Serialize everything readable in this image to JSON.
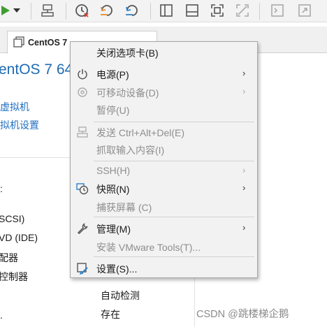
{
  "toolbar": {
    "icons": [
      "power-on-icon",
      "dropdown-arrow-icon",
      "send-ctrl-alt-del-icon",
      "snapshot-icon",
      "revert-snapshot-icon",
      "snapshot-manager-icon",
      "library-icon",
      "thumbnail-icon",
      "full-screen-icon",
      "unity-icon",
      "console-view-icon",
      "stretch-icon"
    ]
  },
  "tab": {
    "title": "CentOS 7"
  },
  "main": {
    "vm_title": "entOS 7 64",
    "links": [
      "虚拟机",
      "拟机设置"
    ],
    "devices": [
      "SCSI)",
      "VD (IDE)",
      "配器",
      "控制器"
    ],
    "right_values": [
      "自动检测",
      "存在"
    ]
  },
  "menu": {
    "items": [
      {
        "label": "关闭选项卡(B)",
        "enabled": true,
        "icon": "",
        "submenu": false
      },
      {
        "label": "电源(P)",
        "enabled": true,
        "icon": "power-icon",
        "submenu": true
      },
      {
        "label": "可移动设备(D)",
        "enabled": false,
        "icon": "removable-device-icon",
        "submenu": true
      },
      {
        "label": "暂停(U)",
        "enabled": false,
        "icon": "",
        "submenu": false
      },
      {
        "label": "发送 Ctrl+Alt+Del(E)",
        "enabled": false,
        "icon": "send-keys-icon",
        "submenu": false
      },
      {
        "label": "抓取输入内容(I)",
        "enabled": false,
        "icon": "",
        "submenu": false
      },
      {
        "label": "SSH(H)",
        "enabled": false,
        "icon": "",
        "submenu": true
      },
      {
        "label": "快照(N)",
        "enabled": true,
        "icon": "snapshot-icon",
        "submenu": true
      },
      {
        "label": "捕获屏幕 (C)",
        "enabled": false,
        "icon": "",
        "submenu": false
      },
      {
        "label": "管理(M)",
        "enabled": true,
        "icon": "wrench-icon",
        "submenu": true
      },
      {
        "label": "安装 VMware Tools(T)...",
        "enabled": false,
        "icon": "",
        "submenu": false
      },
      {
        "label": "设置(S)...",
        "enabled": true,
        "icon": "settings-icon",
        "submenu": false
      }
    ],
    "submenu_arrow": "›"
  },
  "watermark": "CSDN @跳楼梯企鹅",
  "colors": {
    "accent_blue": "#1e6ab3",
    "link_blue": "#1f6fc0",
    "power_green": "#3f9e2f",
    "snapshot_red": "#d9412b",
    "snapshot_orange": "#e8892b",
    "snapshot_blue": "#2f80c8"
  }
}
